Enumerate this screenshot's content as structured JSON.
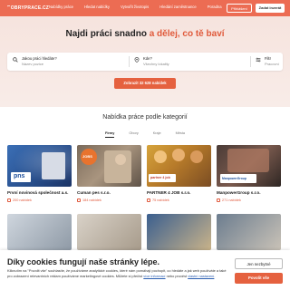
{
  "header": {
    "logo_text": "DOBRYPRACE.CZ",
    "nav": [
      "Nabídky práce",
      "Hledat nabídky",
      "Vytvořit životopis",
      "Hledání zaměstnance",
      "Poradna"
    ],
    "login_label": "Přihlášení",
    "post_label": "Zadat inzerát"
  },
  "hero": {
    "headline_pre": "Najdi práci snadno ",
    "headline_accent": "a dělej, co tě baví",
    "search": {
      "what_label": "Jakou práci hledáte?",
      "what_placeholder": "Název pozice",
      "where_label": "Kde?",
      "where_placeholder": "Všechny lokality",
      "filter_label": "Filtr",
      "filter_placeholder": "Pracovní"
    },
    "cta_label": "Zobrazit 32 628 nabídek"
  },
  "categories": {
    "title": "Nabídka práce podle kategorií",
    "tabs": [
      "Firmy",
      "Obory",
      "Kraje",
      "Města"
    ],
    "active_tab": "Firmy",
    "cards": [
      {
        "name": "První novinová společnost a.s.",
        "count": "200 nabídek"
      },
      {
        "name": "Cuman pes s.r.o.",
        "count": "184 nabídek"
      },
      {
        "name": "PARTNER 4 JOB s.r.o.",
        "count": "75 nabídek"
      },
      {
        "name": "ManpowerGroup s.r.o.",
        "count": "271 nabídek"
      }
    ],
    "logos": [
      "pns",
      "JOBS",
      "partner 4 job",
      "ManpowerGroup"
    ]
  },
  "cookie": {
    "title": "Díky cookies fungují naše stránky lépe.",
    "text": "Kliknutím na \"Povolit vše\" souhlasíte, že používáme analytické cookies, které nám pomáhají pochopit, co hledáte a jak web používáte a také pro zobrazení relevantních reklam používáme marketingové cookies. Můžete si přečíst ",
    "link1": "více informací",
    "text2": " nebo provést ",
    "link2": "vlastní nastavení",
    "text3": ".",
    "btn_necessary": "Jen nezbytné",
    "btn_all": "Povolit vše"
  },
  "colors": {
    "accent": "#e5613f",
    "nav": "#ec6c53"
  }
}
